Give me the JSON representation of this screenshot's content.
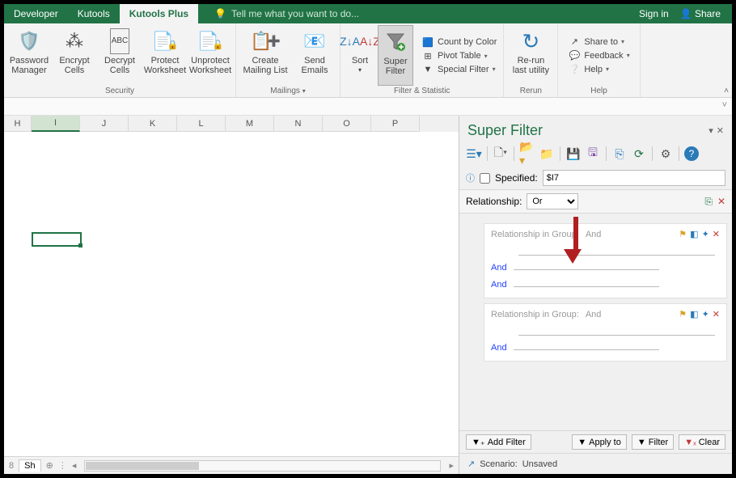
{
  "titlebar": {
    "tabs": [
      {
        "label": "Developer"
      },
      {
        "label": "Kutools"
      },
      {
        "label": "Kutools Plus"
      }
    ],
    "tell_me": "Tell me what you want to do...",
    "sign_in": "Sign in",
    "share": "Share"
  },
  "ribbon": {
    "security": {
      "label": "Security",
      "password_manager": "Password\nManager",
      "encrypt_cells": "Encrypt\nCells",
      "decrypt_cells": "Decrypt\nCells",
      "protect_ws": "Protect\nWorksheet",
      "unprotect_ws": "Unprotect\nWorksheet"
    },
    "mailings": {
      "label": "Mailings",
      "create_list": "Create\nMailing List",
      "send_emails": "Send\nEmails"
    },
    "filter": {
      "label": "Filter & Statistic",
      "sort": "Sort",
      "super_filter": "Super\nFilter",
      "count_color": "Count by Color",
      "pivot_table": "Pivot Table",
      "special_filter": "Special Filter"
    },
    "rerun": {
      "label": "Rerun",
      "btn": "Re-run\nlast utility"
    },
    "help": {
      "label": "Help",
      "share_to": "Share to",
      "feedback": "Feedback",
      "help": "Help"
    }
  },
  "columns": [
    "H",
    "I",
    "J",
    "K",
    "L",
    "M",
    "N",
    "O",
    "P"
  ],
  "sheet_tabs": {
    "tab1": "Sh",
    "add": "⊕"
  },
  "panel": {
    "title": "Super Filter",
    "specified_label": "Specified:",
    "specified_value": "$I7",
    "relationship_label": "Relationship:",
    "relationship_value": "Or",
    "group_label": "Relationship in Group:",
    "group_value": "And",
    "and": "And",
    "or": "Or",
    "add_filter": "Add Filter",
    "apply_to": "Apply to",
    "filter_btn": "Filter",
    "clear_btn": "Clear",
    "scenario_label": "Scenario:",
    "scenario_value": "Unsaved"
  }
}
